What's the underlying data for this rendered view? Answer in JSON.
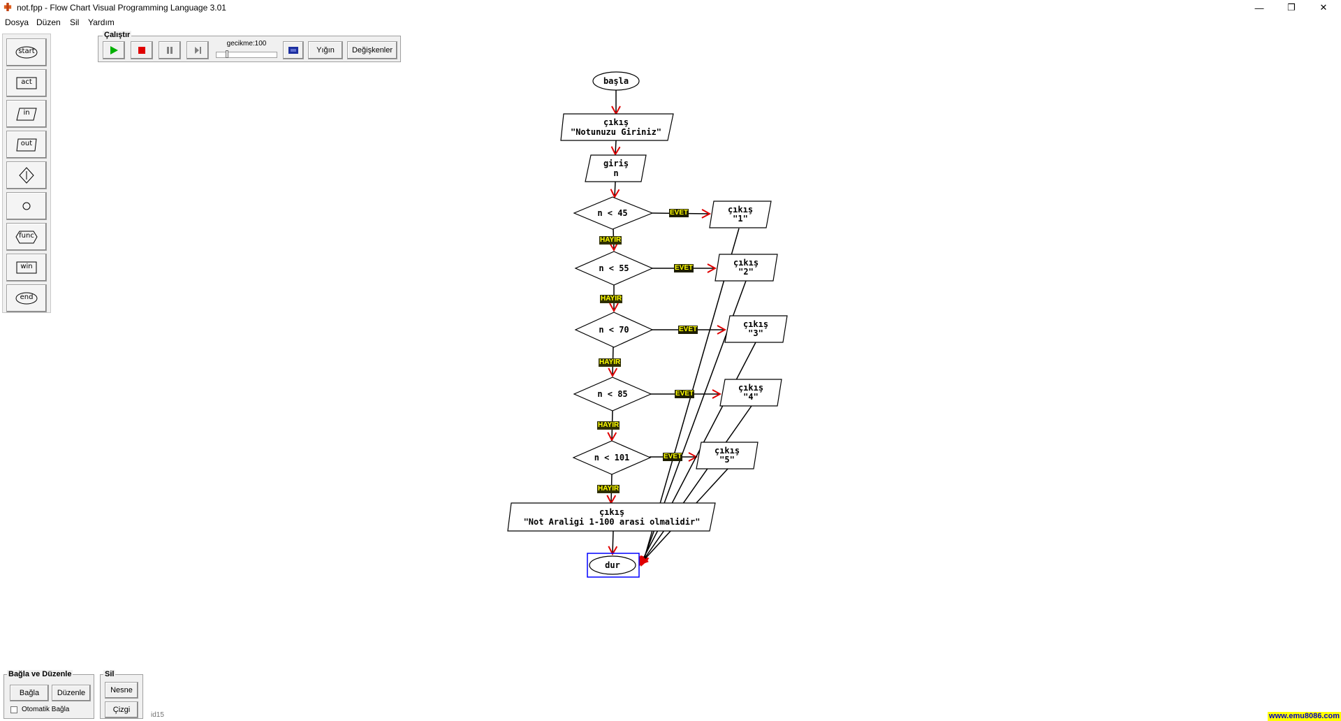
{
  "window": {
    "title": "not.fpp - Flow Chart Visual Programming Language 3.01",
    "minimize": "—",
    "maximize": "❐",
    "close": "✕"
  },
  "menu": [
    "Dosya",
    "Düzen",
    "Sil",
    "Yardım"
  ],
  "palette": [
    "start",
    "act",
    "in",
    "out",
    "<>",
    "o",
    "func",
    "win",
    "end"
  ],
  "run_group": {
    "title": "Çalıştır",
    "delay_label": "gecikme:100",
    "stack_label": "Yığın",
    "variables_label": "Değişkenler"
  },
  "flowchart": {
    "start": "başla",
    "out_prompt": {
      "kw": "çıkış",
      "val": "\"Notunuzu Giriniz\""
    },
    "input": {
      "kw": "giriş",
      "val": "n"
    },
    "conditions": [
      "n < 45",
      "n < 55",
      "n < 70",
      "n < 85",
      "n < 101"
    ],
    "outputs": [
      {
        "kw": "çıkış",
        "val": "\"1\""
      },
      {
        "kw": "çıkış",
        "val": "\"2\""
      },
      {
        "kw": "çıkış",
        "val": "\"3\""
      },
      {
        "kw": "çıkış",
        "val": "\"4\""
      },
      {
        "kw": "çıkış",
        "val": "\"5\""
      }
    ],
    "out_error": {
      "kw": "çıkış",
      "val": "\"Not Araligi 1-100 arasi olmalidir\""
    },
    "end": "dur",
    "yes_label": "EVET",
    "no_label": "HAYIR"
  },
  "connect_group": {
    "title": "Bağla ve Düzenle",
    "connect_label": "Bağla",
    "arrange_label": "Düzenle",
    "auto_connect_label": "Otomatik Bağla"
  },
  "delete_group": {
    "title": "Sil",
    "object_label": "Nesne",
    "line_label": "Çizgi"
  },
  "status": {
    "id": "id15",
    "link": "www.emu8086.com"
  },
  "colors": {
    "arrow": "#e00000",
    "selection": "#0000ff",
    "tag_text": "#ffff00",
    "play": "#00b000",
    "stop": "#e00000"
  }
}
